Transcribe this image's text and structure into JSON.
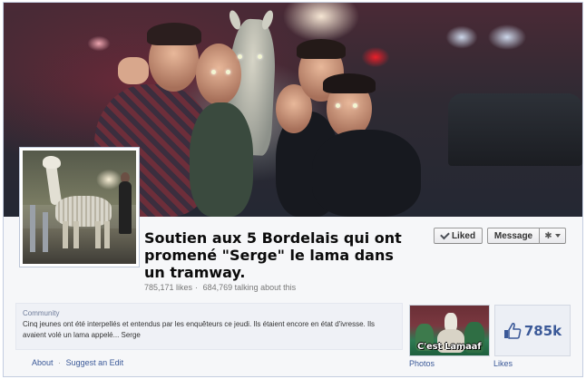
{
  "page": {
    "title": "Soutien aux 5 Bordelais qui ont promené \"Serge\" le lama dans un tramway.",
    "likes_text": "785,171 likes",
    "separator": "·",
    "talking_text": "684,769 talking about this"
  },
  "actions": {
    "liked_label": "Liked",
    "message_label": "Message"
  },
  "about": {
    "category": "Community",
    "description": "Cinq jeunes ont été interpellés et entendus par les enquêteurs ce jeudi. Ils étaient encore en état d'ivresse. Ils avaient volé un lama appelé... Serge",
    "links": {
      "about": "About",
      "suggest_edit": "Suggest an Edit",
      "sep": "·"
    }
  },
  "tiles": {
    "photos": {
      "caption": "C'est Lamaaf",
      "label": "Photos"
    },
    "likes": {
      "count": "785k",
      "label": "Likes"
    }
  },
  "colors": {
    "link": "#3b5998",
    "frame_border": "#c4cde0",
    "panel_bg": "#f6f7f9"
  },
  "icons": [
    "check-icon",
    "gear-icon",
    "chevron-down-icon",
    "thumbs-up-icon"
  ]
}
